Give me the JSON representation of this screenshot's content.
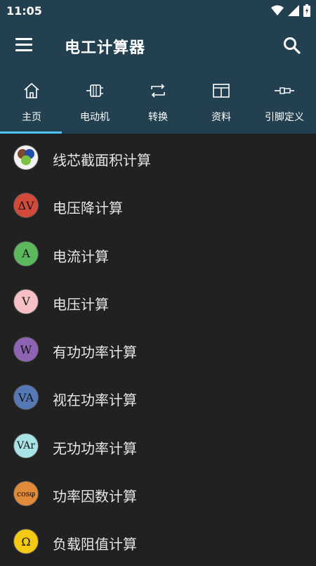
{
  "status": {
    "time": "11:05"
  },
  "appbar": {
    "title": "电工计算器"
  },
  "tabs": [
    {
      "label": "主页",
      "icon": "home-icon"
    },
    {
      "label": "电动机",
      "icon": "motor-icon"
    },
    {
      "label": "转换",
      "icon": "convert-icon"
    },
    {
      "label": "资料",
      "icon": "table-icon"
    },
    {
      "label": "引脚定义",
      "icon": "connector-icon"
    }
  ],
  "active_tab": 0,
  "items": [
    {
      "label": "线芯截面积计算",
      "badge": "",
      "color": "#f2f2f2"
    },
    {
      "label": "电压降计算",
      "badge": "ΔV",
      "color": "#d44a3a"
    },
    {
      "label": "电流计算",
      "badge": "A",
      "color": "#5cb85c"
    },
    {
      "label": "电压计算",
      "badge": "V",
      "color": "#f7c0c5"
    },
    {
      "label": "有功功率计算",
      "badge": "W",
      "color": "#8e63b4"
    },
    {
      "label": "视在功率计算",
      "badge": "VA",
      "color": "#5579b6"
    },
    {
      "label": "无功功率计算",
      "badge": "VAr",
      "color": "#a9e3e6"
    },
    {
      "label": "功率因数计算",
      "badge": "cosφ",
      "color": "#e08a3a"
    },
    {
      "label": "负载阻值计算",
      "badge": "Ω",
      "color": "#f3c913"
    }
  ]
}
